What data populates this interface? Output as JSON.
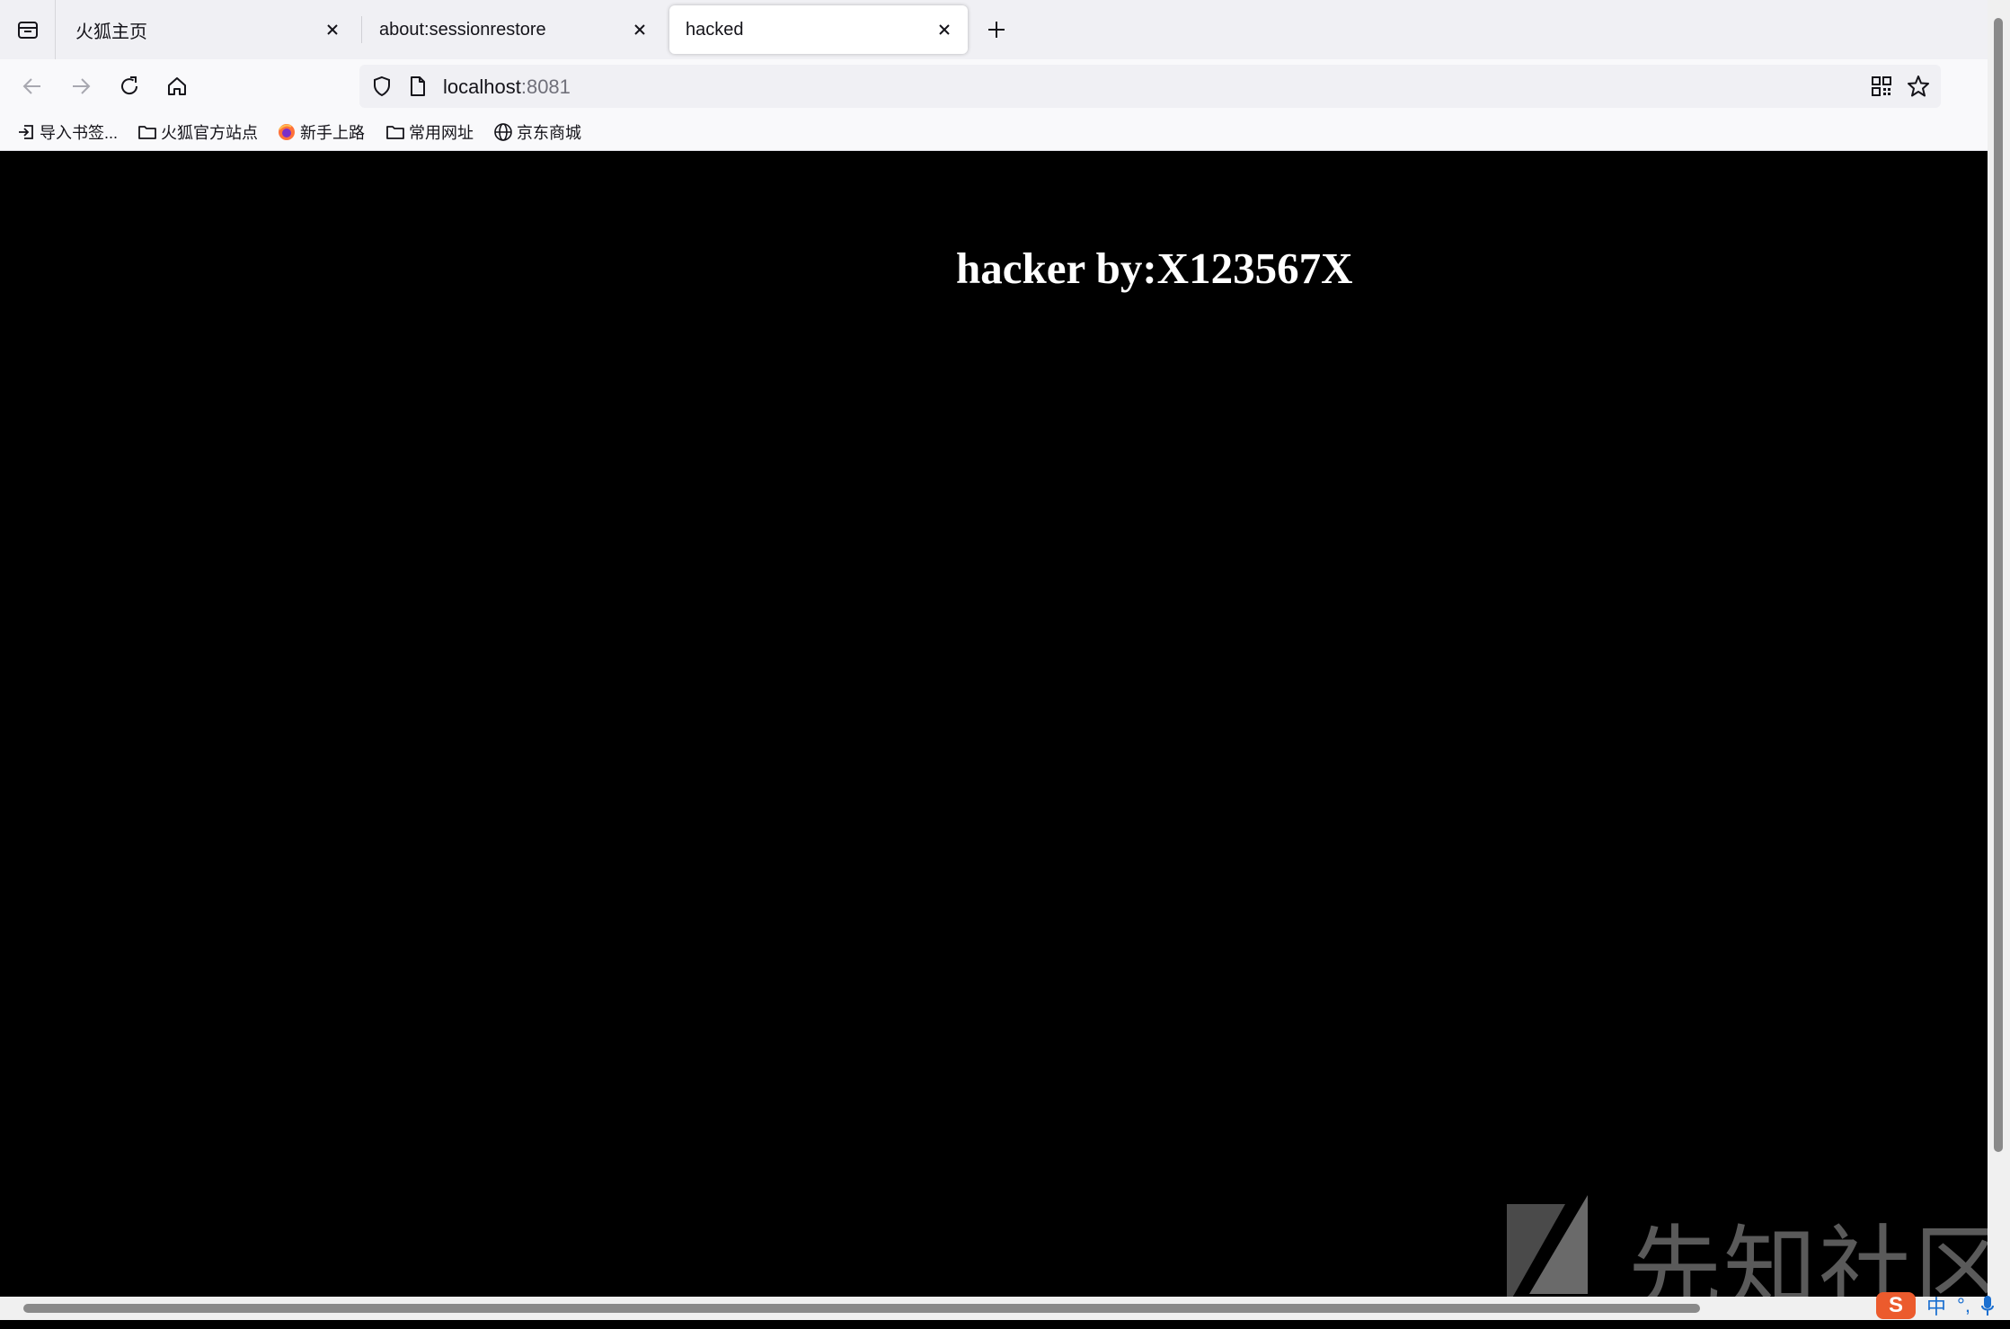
{
  "tabs": [
    {
      "label": "火狐主页"
    },
    {
      "label": "about:sessionrestore"
    },
    {
      "label": "hacked",
      "active": true
    }
  ],
  "address": {
    "host": "localhost",
    "port": ":8081"
  },
  "bookmarks": [
    {
      "label": "导入书签...",
      "icon": "import-icon"
    },
    {
      "label": "火狐官方站点",
      "icon": "folder-icon"
    },
    {
      "label": "新手上路",
      "icon": "firefox-icon"
    },
    {
      "label": "常用网址",
      "icon": "folder-icon"
    },
    {
      "label": "京东商城",
      "icon": "globe-icon"
    }
  ],
  "page": {
    "title": "hacker by:X123567X"
  },
  "watermark": {
    "text": "先知社区"
  },
  "ime": {
    "mode": "中",
    "punct": "°,"
  },
  "colors": {
    "page_bg": "#000000",
    "title_fg": "#ffffff",
    "chrome_bg": "#f0f0f4"
  }
}
